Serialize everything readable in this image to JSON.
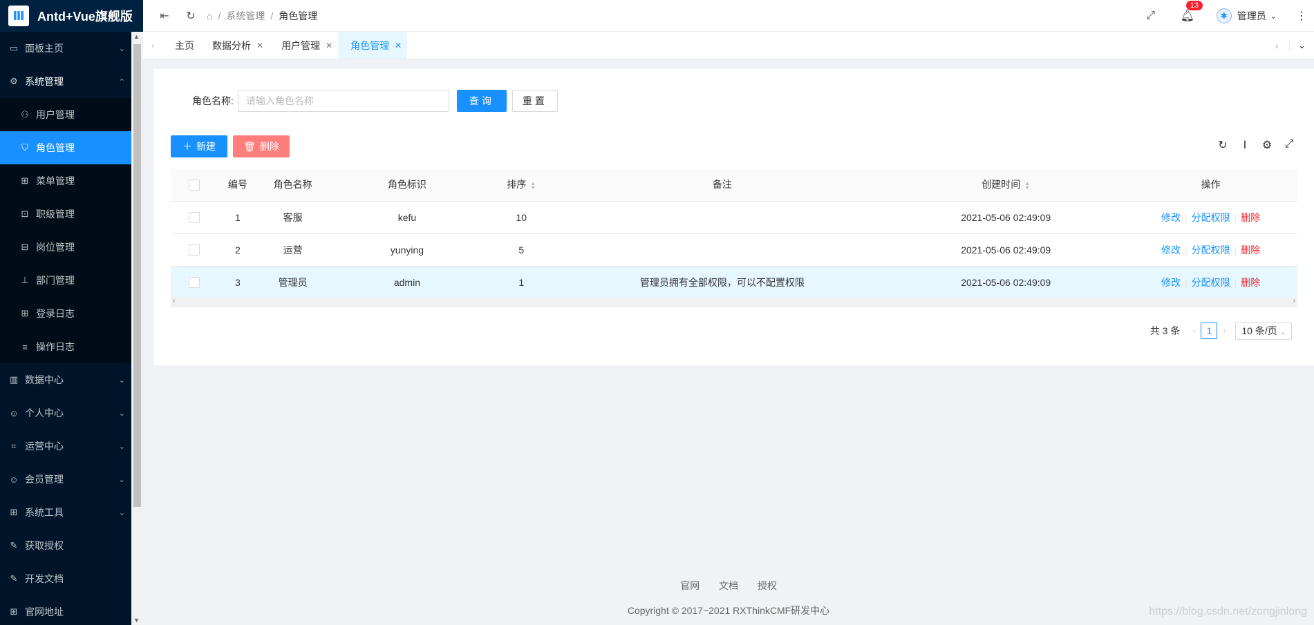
{
  "app": {
    "logo_text": "Antd+Vue旗舰版",
    "logo_glyph": "Ⅲ"
  },
  "sidebar": {
    "items": [
      {
        "label": "面板主页",
        "icon": "monitor-icon",
        "glyph": "▭"
      },
      {
        "label": "系统管理",
        "icon": "gear-icon",
        "glyph": "⚙"
      },
      {
        "label": "数据中心",
        "icon": "chart-icon",
        "glyph": "▥"
      },
      {
        "label": "个人中心",
        "icon": "user-icon",
        "glyph": "☺"
      },
      {
        "label": "运营中心",
        "icon": "scan-icon",
        "glyph": "⌗"
      },
      {
        "label": "会员管理",
        "icon": "user-icon",
        "glyph": "☺"
      },
      {
        "label": "系统工具",
        "icon": "tools-icon",
        "glyph": "⊞"
      },
      {
        "label": "获取授权",
        "icon": "auth-icon",
        "glyph": "✎"
      },
      {
        "label": "开发文档",
        "icon": "docs-icon",
        "glyph": "✎"
      },
      {
        "label": "官网地址",
        "icon": "site-icon",
        "glyph": "⊞"
      }
    ],
    "sub_items": [
      {
        "label": "用户管理",
        "icon": "users-icon",
        "glyph": "⚇"
      },
      {
        "label": "角色管理",
        "icon": "shield-icon",
        "glyph": "⛉"
      },
      {
        "label": "菜单管理",
        "icon": "table-icon",
        "glyph": "⊞"
      },
      {
        "label": "职级管理",
        "icon": "rank-icon",
        "glyph": "⊡"
      },
      {
        "label": "岗位管理",
        "icon": "post-icon",
        "glyph": "⊟"
      },
      {
        "label": "部门管理",
        "icon": "dept-icon",
        "glyph": "⊥"
      },
      {
        "label": "登录日志",
        "icon": "log-icon",
        "glyph": "⊞"
      },
      {
        "label": "操作日志",
        "icon": "list-icon",
        "glyph": "≡"
      }
    ]
  },
  "breadcrumb": {
    "level1": "系统管理",
    "current": "角色管理"
  },
  "header": {
    "badge_count": "13",
    "username": "管理员"
  },
  "tabs": [
    {
      "label": "主页"
    },
    {
      "label": "数据分析"
    },
    {
      "label": "用户管理"
    },
    {
      "label": "角色管理"
    }
  ],
  "search": {
    "label": "角色名称:",
    "placeholder": "请输入角色名称",
    "query_button": "查询",
    "reset_button": "重置"
  },
  "toolbar": {
    "new_button": "新建",
    "delete_button": "删除"
  },
  "table": {
    "headers": {
      "id": "编号",
      "name": "角色名称",
      "code": "角色标识",
      "sort": "排序",
      "note": "备注",
      "created": "创建时间",
      "actions": "操作"
    },
    "rows": [
      {
        "id": "1",
        "name": "客服",
        "code": "kefu",
        "sort": "10",
        "note": "",
        "created": "2021-05-06 02:49:09"
      },
      {
        "id": "2",
        "name": "运营",
        "code": "yunying",
        "sort": "5",
        "note": "",
        "created": "2021-05-06 02:49:09"
      },
      {
        "id": "3",
        "name": "管理员",
        "code": "admin",
        "sort": "1",
        "note": "管理员拥有全部权限，可以不配置权限",
        "created": "2021-05-06 02:49:09"
      }
    ],
    "action_labels": {
      "edit": "修改",
      "assign": "分配权限",
      "delete": "删除"
    }
  },
  "pagination": {
    "total": "共 3 条",
    "current": "1",
    "page_size": "10 条/页"
  },
  "footer": {
    "links": [
      "官网",
      "文档",
      "授权"
    ],
    "copyright": "Copyright © 2017~2021 RXThinkCMF研发中心"
  },
  "watermark": "https://blog.csdn.net/zongjinlong",
  "colors": {
    "primary": "#1890ff",
    "sidebar_bg": "#001529",
    "danger": "#f5222d"
  }
}
